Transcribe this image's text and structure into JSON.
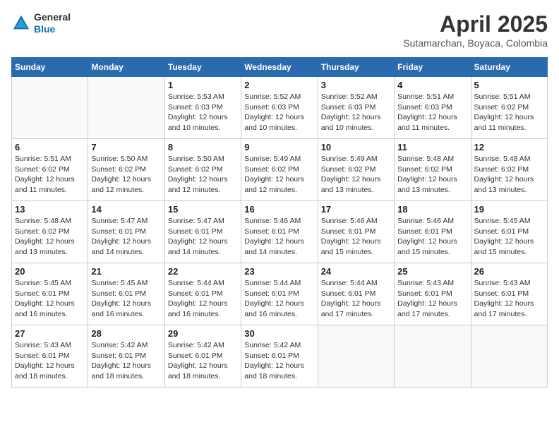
{
  "header": {
    "logo_general": "General",
    "logo_blue": "Blue",
    "title": "April 2025",
    "subtitle": "Sutamarchan, Boyaca, Colombia"
  },
  "days_of_week": [
    "Sunday",
    "Monday",
    "Tuesday",
    "Wednesday",
    "Thursday",
    "Friday",
    "Saturday"
  ],
  "weeks": [
    [
      {
        "day": "",
        "info": ""
      },
      {
        "day": "",
        "info": ""
      },
      {
        "day": "1",
        "info": "Sunrise: 5:53 AM\nSunset: 6:03 PM\nDaylight: 12 hours and 10 minutes."
      },
      {
        "day": "2",
        "info": "Sunrise: 5:52 AM\nSunset: 6:03 PM\nDaylight: 12 hours and 10 minutes."
      },
      {
        "day": "3",
        "info": "Sunrise: 5:52 AM\nSunset: 6:03 PM\nDaylight: 12 hours and 10 minutes."
      },
      {
        "day": "4",
        "info": "Sunrise: 5:51 AM\nSunset: 6:03 PM\nDaylight: 12 hours and 11 minutes."
      },
      {
        "day": "5",
        "info": "Sunrise: 5:51 AM\nSunset: 6:02 PM\nDaylight: 12 hours and 11 minutes."
      }
    ],
    [
      {
        "day": "6",
        "info": "Sunrise: 5:51 AM\nSunset: 6:02 PM\nDaylight: 12 hours and 11 minutes."
      },
      {
        "day": "7",
        "info": "Sunrise: 5:50 AM\nSunset: 6:02 PM\nDaylight: 12 hours and 12 minutes."
      },
      {
        "day": "8",
        "info": "Sunrise: 5:50 AM\nSunset: 6:02 PM\nDaylight: 12 hours and 12 minutes."
      },
      {
        "day": "9",
        "info": "Sunrise: 5:49 AM\nSunset: 6:02 PM\nDaylight: 12 hours and 12 minutes."
      },
      {
        "day": "10",
        "info": "Sunrise: 5:49 AM\nSunset: 6:02 PM\nDaylight: 12 hours and 13 minutes."
      },
      {
        "day": "11",
        "info": "Sunrise: 5:48 AM\nSunset: 6:02 PM\nDaylight: 12 hours and 13 minutes."
      },
      {
        "day": "12",
        "info": "Sunrise: 5:48 AM\nSunset: 6:02 PM\nDaylight: 12 hours and 13 minutes."
      }
    ],
    [
      {
        "day": "13",
        "info": "Sunrise: 5:48 AM\nSunset: 6:02 PM\nDaylight: 12 hours and 13 minutes."
      },
      {
        "day": "14",
        "info": "Sunrise: 5:47 AM\nSunset: 6:01 PM\nDaylight: 12 hours and 14 minutes."
      },
      {
        "day": "15",
        "info": "Sunrise: 5:47 AM\nSunset: 6:01 PM\nDaylight: 12 hours and 14 minutes."
      },
      {
        "day": "16",
        "info": "Sunrise: 5:46 AM\nSunset: 6:01 PM\nDaylight: 12 hours and 14 minutes."
      },
      {
        "day": "17",
        "info": "Sunrise: 5:46 AM\nSunset: 6:01 PM\nDaylight: 12 hours and 15 minutes."
      },
      {
        "day": "18",
        "info": "Sunrise: 5:46 AM\nSunset: 6:01 PM\nDaylight: 12 hours and 15 minutes."
      },
      {
        "day": "19",
        "info": "Sunrise: 5:45 AM\nSunset: 6:01 PM\nDaylight: 12 hours and 15 minutes."
      }
    ],
    [
      {
        "day": "20",
        "info": "Sunrise: 5:45 AM\nSunset: 6:01 PM\nDaylight: 12 hours and 16 minutes."
      },
      {
        "day": "21",
        "info": "Sunrise: 5:45 AM\nSunset: 6:01 PM\nDaylight: 12 hours and 16 minutes."
      },
      {
        "day": "22",
        "info": "Sunrise: 5:44 AM\nSunset: 6:01 PM\nDaylight: 12 hours and 16 minutes."
      },
      {
        "day": "23",
        "info": "Sunrise: 5:44 AM\nSunset: 6:01 PM\nDaylight: 12 hours and 16 minutes."
      },
      {
        "day": "24",
        "info": "Sunrise: 5:44 AM\nSunset: 6:01 PM\nDaylight: 12 hours and 17 minutes."
      },
      {
        "day": "25",
        "info": "Sunrise: 5:43 AM\nSunset: 6:01 PM\nDaylight: 12 hours and 17 minutes."
      },
      {
        "day": "26",
        "info": "Sunrise: 5:43 AM\nSunset: 6:01 PM\nDaylight: 12 hours and 17 minutes."
      }
    ],
    [
      {
        "day": "27",
        "info": "Sunrise: 5:43 AM\nSunset: 6:01 PM\nDaylight: 12 hours and 18 minutes."
      },
      {
        "day": "28",
        "info": "Sunrise: 5:42 AM\nSunset: 6:01 PM\nDaylight: 12 hours and 18 minutes."
      },
      {
        "day": "29",
        "info": "Sunrise: 5:42 AM\nSunset: 6:01 PM\nDaylight: 12 hours and 18 minutes."
      },
      {
        "day": "30",
        "info": "Sunrise: 5:42 AM\nSunset: 6:01 PM\nDaylight: 12 hours and 18 minutes."
      },
      {
        "day": "",
        "info": ""
      },
      {
        "day": "",
        "info": ""
      },
      {
        "day": "",
        "info": ""
      }
    ]
  ]
}
